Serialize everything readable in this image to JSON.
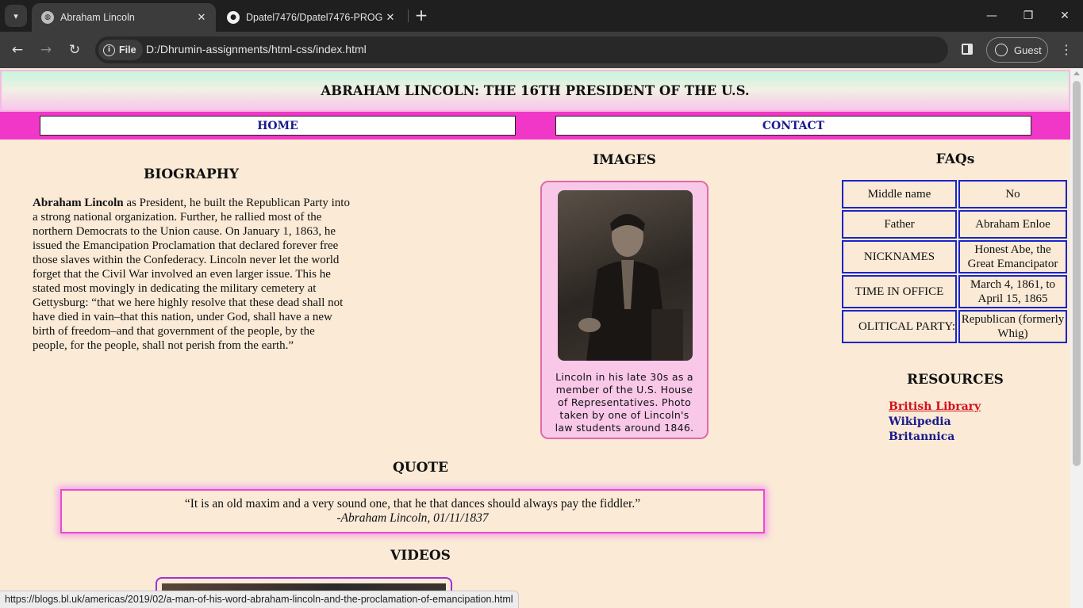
{
  "browser": {
    "tabs": [
      {
        "title": "Abraham Lincoln",
        "active": true,
        "icon": "globe-icon"
      },
      {
        "title": "Dpatel7476/Dpatel7476-PROG",
        "active": false,
        "icon": "github-icon"
      }
    ],
    "url_chip": "File",
    "url": "D:/Dhrumin-assignments/html-css/index.html",
    "profile": "Guest",
    "status_url": "https://blogs.bl.uk/americas/2019/02/a-man-of-his-word-abraham-lincoln-and-the-proclamation-of-emancipation.html"
  },
  "page": {
    "title": "ABRAHAM LINCOLN: THE 16TH PRESIDENT OF THE U.S.",
    "nav": {
      "home": "HOME",
      "contact": "CONTACT"
    },
    "biography": {
      "heading": "BIOGRAPHY",
      "name": "Abraham Lincoln",
      "text": " as President, he built the Republican Party into a strong national organization. Further, he rallied most of the northern Democrats to the Union cause. On January 1, 1863, he issued the Emancipation Proclamation that declared forever free those slaves within the Confederacy. Lincoln never let the world forget that the Civil War involved an even larger issue. This he stated most movingly in dedicating the military cemetery at Gettysburg: “that we here highly resolve that these dead shall not have died in vain–that this nation, under God, shall have a new birth of freedom–and that government of the people, by the people, for the people, shall not perish from the earth.”"
    },
    "images": {
      "heading": "IMAGES",
      "caption": "Lincoln in his late 30s as a member of the U.S. House of Representatives. Photo taken by one of Lincoln's law students around 1846."
    },
    "faqs": {
      "heading": "FAQs",
      "rows": [
        {
          "q": "Middle name",
          "a": "No"
        },
        {
          "q": "Father",
          "a": "Abraham Enloe"
        },
        {
          "q": "NICKNAMES",
          "a": "Honest Abe, the Great Emancipator"
        },
        {
          "q": "TIME IN OFFICE",
          "a": "March 4, 1861, to April 15, 1865"
        },
        {
          "q": "OLITICAL PARTY:",
          "a": "Republican (formerly Whig)"
        }
      ]
    },
    "resources": {
      "heading": "RESOURCES",
      "links": [
        "British Library",
        "Wikipedia",
        "Britannica"
      ]
    },
    "quote": {
      "heading": "QUOTE",
      "text": "“It is an old maxim and a very sound one, that he that dances should always pay the fiddler.”",
      "by": "-Abraham Lincoln, 01/11/1837"
    },
    "videos": {
      "heading": "VIDEOS"
    }
  }
}
